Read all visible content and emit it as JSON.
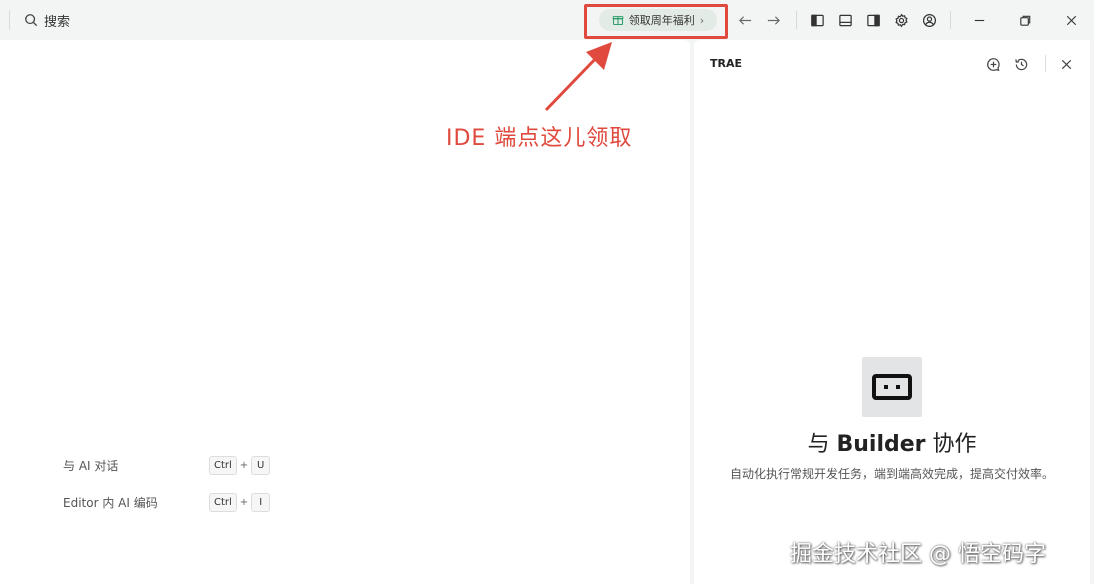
{
  "titlebar": {
    "search_label": "搜索",
    "promo_label": "领取周年福利",
    "promo_chevron": "›",
    "icons": [
      "search-icon",
      "gift-icon",
      "arrow-left-icon",
      "arrow-right-icon",
      "toggle-left-panel-icon",
      "toggle-bottom-panel-icon",
      "toggle-right-panel-icon",
      "gear-icon",
      "account-icon",
      "minimize-icon",
      "restore-icon",
      "close-icon"
    ]
  },
  "editor": {
    "shortcuts": [
      {
        "label": "与 AI 对话",
        "keys": [
          "Ctrl",
          "U"
        ]
      },
      {
        "label": "Editor 内 AI 编码",
        "keys": [
          "Ctrl",
          "I"
        ]
      }
    ],
    "key_separator": "+"
  },
  "annotation": {
    "text": "IDE 端点这儿领取",
    "color": "#e0493d"
  },
  "panel": {
    "title": "TRAE",
    "builder_prefix": "与",
    "builder_name": "Builder",
    "builder_suffix": "协作",
    "description": "自动化执行常规开发任务，端到端高效完成，提高交付效率。"
  },
  "watermark": "掘金技术社区 @ 悟空码字",
  "colors": {
    "accent_red": "#e0493d",
    "promo_bg": "#e3ebe6",
    "promo_icon": "#2e9e6b"
  }
}
